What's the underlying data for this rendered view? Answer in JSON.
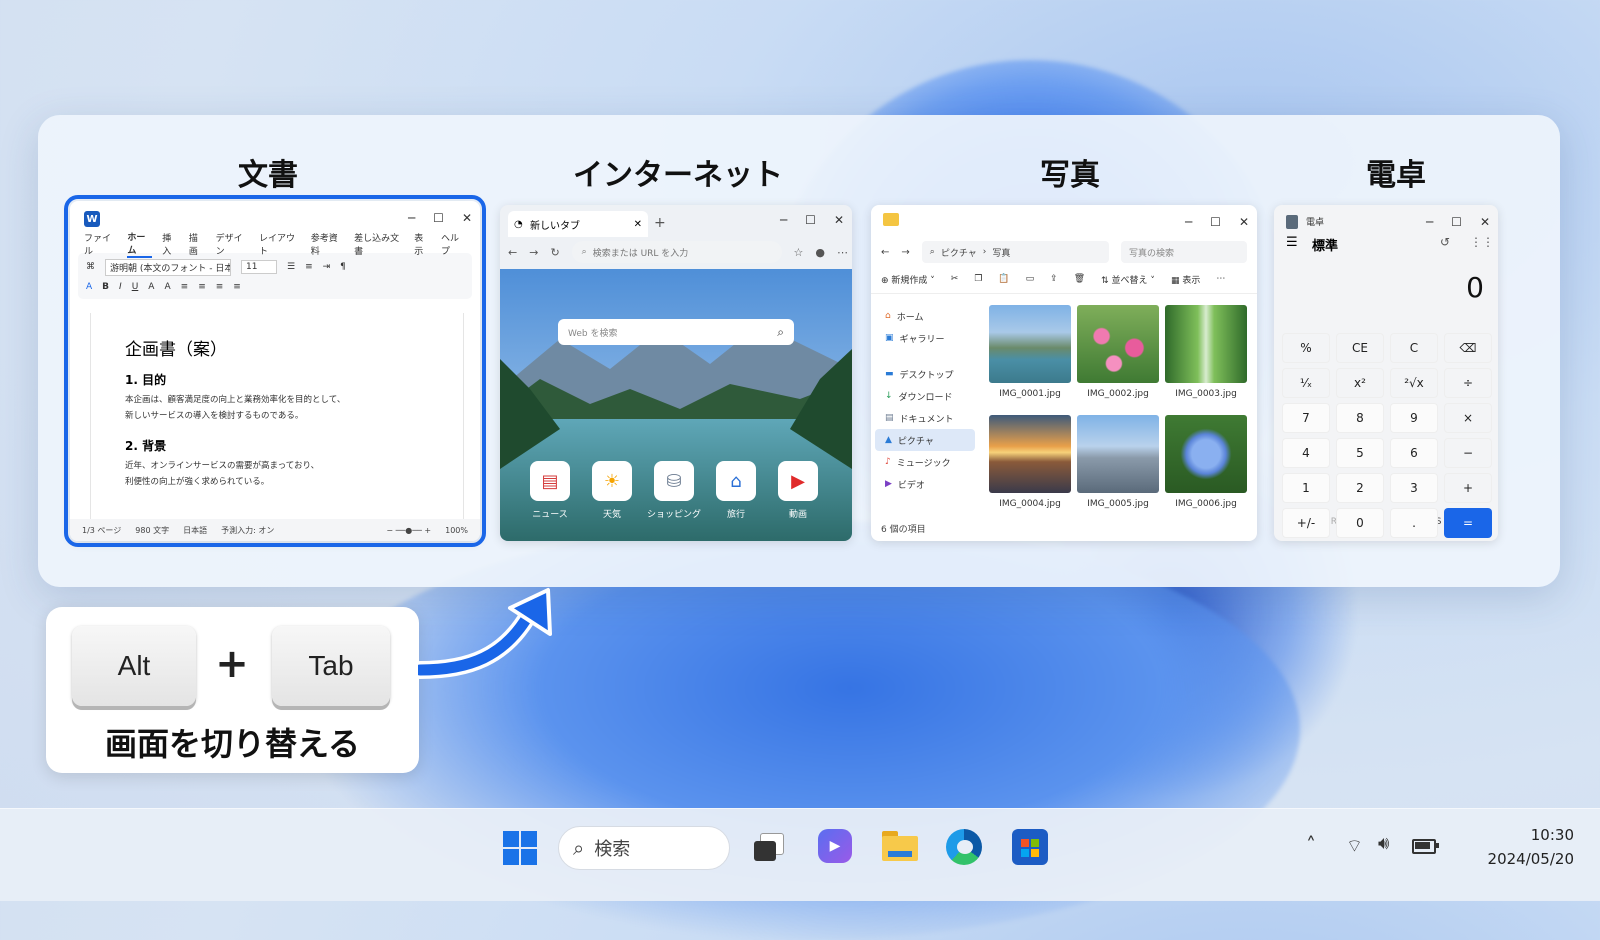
{
  "switcher": {
    "titles": [
      "文書",
      "インターネット",
      "写真",
      "電卓"
    ]
  },
  "word": {
    "menu": [
      "ファイル",
      "ホーム",
      "挿入",
      "描画",
      "デザイン",
      "レイアウト",
      "参考資料",
      "差し込み文書",
      "表示",
      "ヘルプ"
    ],
    "font_name": "游明朝 (本文のフォント - 日本語)",
    "font_size": "11",
    "doc": {
      "title": "企画書（案）",
      "h1": "1. 目的",
      "p1a": "本企画は、顧客満足度の向上と業務効率化を目的として、",
      "p1b": "新しいサービスの導入を検討するものである。",
      "h2": "2. 背景",
      "p2a": "近年、オンラインサービスの需要が高まっており、",
      "p2b": "利便性の向上が強く求められている。"
    },
    "status": {
      "page": "1/3 ページ",
      "words": "980 文字",
      "lang": "日本語",
      "input": "予測入力: オン",
      "zoom": "100%"
    }
  },
  "edge": {
    "tab_title": "新しいタブ",
    "address_placeholder": "検索または URL を入力",
    "search_placeholder": "Web を検索",
    "quicklinks": [
      "ニュース",
      "天気",
      "ショッピング",
      "旅行",
      "動画"
    ]
  },
  "explorer": {
    "breadcrumb": [
      "ピクチャ",
      "写真"
    ],
    "search_placeholder": "写真の検索",
    "cmd": {
      "new": "新規作成",
      "sort": "並べ替え",
      "view": "表示"
    },
    "sidebar": [
      "ホーム",
      "ギャラリー",
      "デスクトップ",
      "ダウンロード",
      "ドキュメント",
      "ピクチャ",
      "ミュージック",
      "ビデオ"
    ],
    "files": [
      "IMG_0001.jpg",
      "IMG_0002.jpg",
      "IMG_0003.jpg",
      "IMG_0004.jpg",
      "IMG_0005.jpg",
      "IMG_0006.jpg"
    ],
    "status": "6 個の項目"
  },
  "calculator": {
    "title": "電卓",
    "mode": "標準",
    "display": "0",
    "memory": [
      "MC",
      "MR",
      "M+",
      "M-",
      "MS",
      "M˅"
    ],
    "keys": [
      "%",
      "CE",
      "C",
      "⌫",
      "¹⁄ₓ",
      "x²",
      "²√x",
      "÷",
      "7",
      "8",
      "9",
      "×",
      "4",
      "5",
      "6",
      "−",
      "1",
      "2",
      "3",
      "+",
      "+/-",
      "0",
      ".",
      "="
    ]
  },
  "hint": {
    "key1": "Alt",
    "plus": "+",
    "key2": "Tab",
    "label": "画面を切り替える"
  },
  "taskbar": {
    "search_placeholder": "検索",
    "time": "10:30",
    "date": "2024/05/20"
  }
}
